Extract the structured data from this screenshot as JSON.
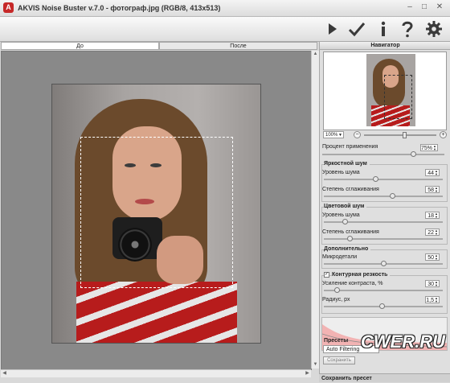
{
  "window": {
    "title": "AKVIS Noise Buster v.7.0 - фотограф.jpg (RGB/8, 413x513)",
    "logo_icon": "akvis-logo-icon",
    "minimize_glyph": "–",
    "maximize_glyph": "□",
    "close_glyph": "✕"
  },
  "toolbar": {
    "buttons": [
      {
        "name": "run-icon"
      },
      {
        "name": "apply-check-icon"
      },
      {
        "name": "info-icon",
        "glyph": "i"
      },
      {
        "name": "help-icon",
        "glyph": "?"
      },
      {
        "name": "settings-gear-icon"
      }
    ]
  },
  "tabs": {
    "before": "До",
    "after": "После"
  },
  "navigator": {
    "title": "Навигатор",
    "zoom": "100%",
    "zoom_out": "−",
    "zoom_in": "+"
  },
  "settings": {
    "apply_percent_label": "Процент применения",
    "apply_percent_value": "75%",
    "luminance_title": "Яркостной шум",
    "luminance_level_label": "Уровень шума",
    "luminance_level_value": "44",
    "luminance_smooth_label": "Степень сглаживания",
    "luminance_smooth_value": "58",
    "color_title": "Цветовой шум",
    "color_level_label": "Уровень шума",
    "color_level_value": "18",
    "color_smooth_label": "Степень сглаживания",
    "color_smooth_value": "22",
    "extra_title": "Дополнительно",
    "micro_label": "Микродетали",
    "micro_value": "50",
    "sharpen_title": "Контурная резкость",
    "sharpen_checked": true,
    "sharpen_check_glyph": "✓",
    "contrast_label": "Усиление контраста, %",
    "contrast_value": "30",
    "radius_label": "Радиус, px",
    "radius_value": "1,5"
  },
  "presets": {
    "title": "Пресеты",
    "selected": "Auto Filtering",
    "save_label": "Сохранить"
  },
  "status": {
    "text": "Сохранить пресет"
  },
  "watermark": "CWER.RU"
}
